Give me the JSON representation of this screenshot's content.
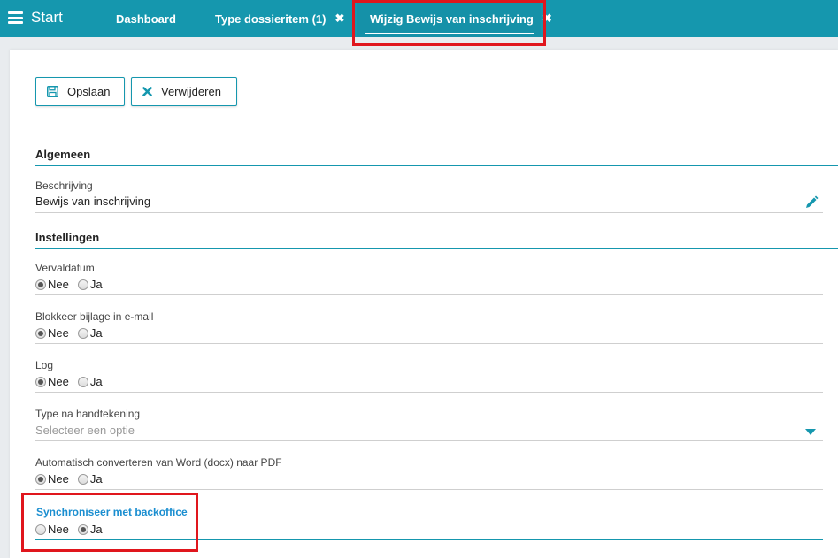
{
  "nav": {
    "start_label": "Start",
    "tabs": [
      {
        "label": "Dashboard"
      },
      {
        "label": "Type dossieritem (1)",
        "close": "✖"
      },
      {
        "label": "Wijzig Bewijs van inschrijving",
        "close": "✖"
      }
    ]
  },
  "toolbar": {
    "save_label": "Opslaan",
    "save_icon": "floppy-disk-icon",
    "delete_label": "Verwijderen",
    "delete_icon": "x-icon"
  },
  "sections": {
    "general": "Algemeen",
    "settings": "Instellingen"
  },
  "fields": {
    "beschrijving": {
      "label": "Beschrijving",
      "value": "Bewijs van inschrijving"
    },
    "vervaldatum": {
      "label": "Vervaldatum",
      "options": [
        "Nee",
        "Ja"
      ],
      "selected": "Nee"
    },
    "blokkeer": {
      "label": "Blokkeer bijlage in e-mail",
      "options": [
        "Nee",
        "Ja"
      ],
      "selected": "Nee"
    },
    "log": {
      "label": "Log",
      "options": [
        "Nee",
        "Ja"
      ],
      "selected": "Nee"
    },
    "type_handtekening": {
      "label": "Type na handtekening",
      "placeholder": "Selecteer een optie"
    },
    "converteren": {
      "label": "Automatisch converteren van Word (docx) naar PDF",
      "options": [
        "Nee",
        "Ja"
      ],
      "selected": "Nee"
    },
    "synchroniseer": {
      "label": "Synchroniseer met backoffice",
      "options": [
        "Nee",
        "Ja"
      ],
      "selected": "Ja"
    }
  },
  "colors": {
    "accent": "#1597ae",
    "highlight": "#e0161d",
    "focus_label": "#1a8ed0"
  }
}
